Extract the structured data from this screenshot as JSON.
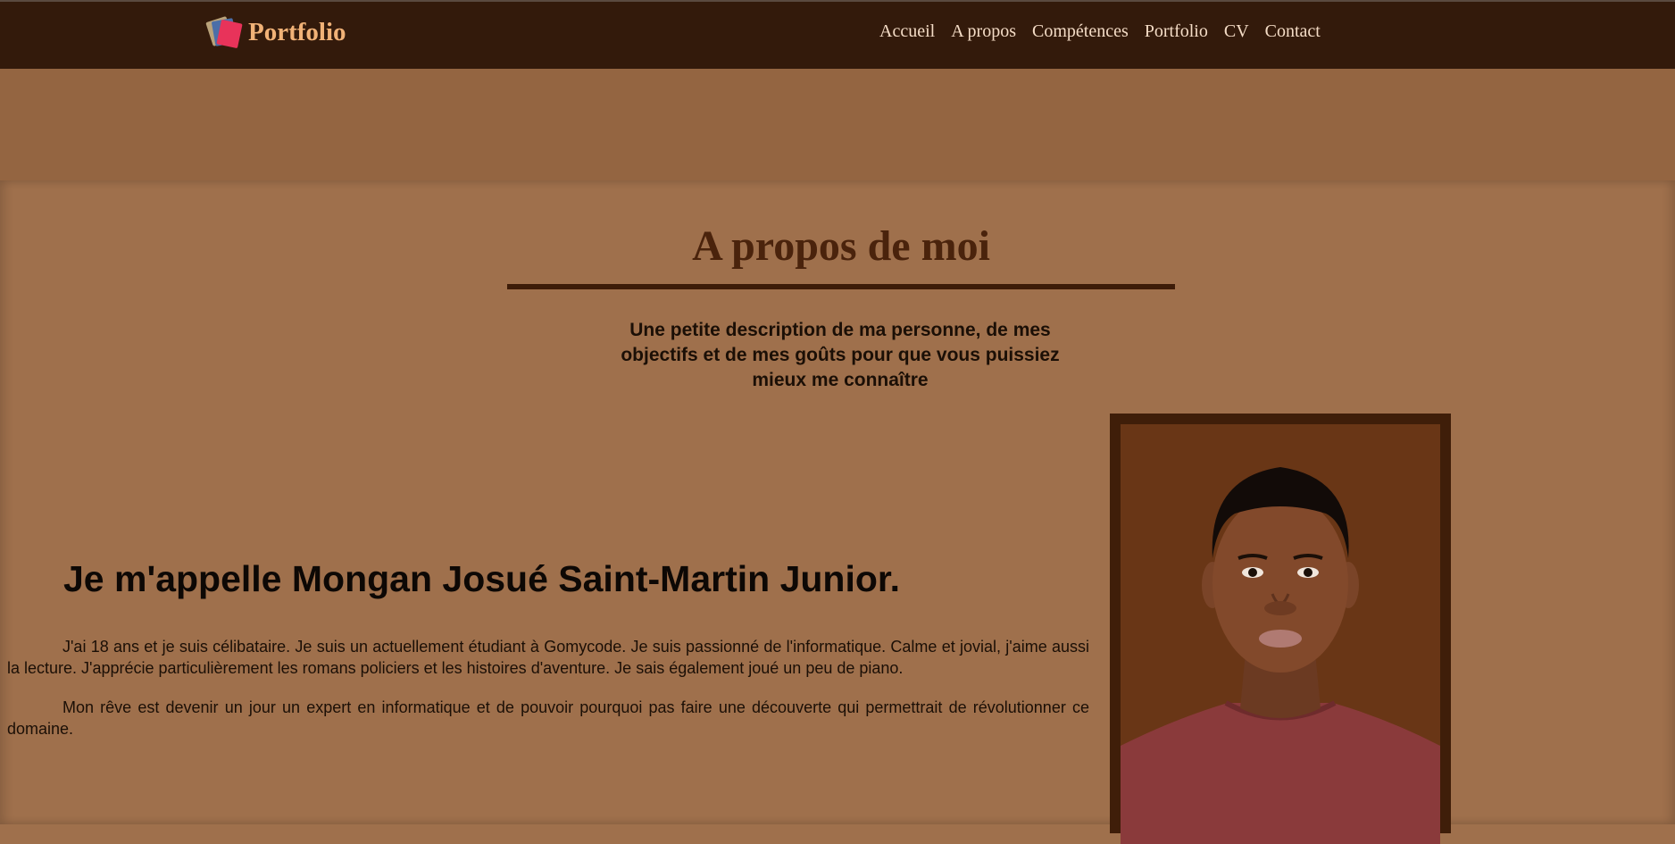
{
  "nav": {
    "brand": "Portfolio",
    "brand_icon": "books-icon",
    "links": [
      "Accueil",
      "A propos",
      "Compétences",
      "Portfolio",
      "CV",
      "Contact"
    ]
  },
  "about": {
    "title": "A propos de moi",
    "subtitle": "Une petite description de ma personne, de mes objectifs et de mes goûts pour que vous puissiez mieux me connaître",
    "name_heading": "Je m'appelle Mongan Josué Saint-Martin Junior.",
    "paragraph_1": "J'ai 18 ans et je suis célibataire. Je suis un actuellement étudiant à Gomycode. Je suis passionné de l'informatique. Calme et jovial, j'aime aussi la lecture. J'apprécie particulièrement les romans policiers et les histoires d'aventure. Je sais également joué un peu de piano.",
    "paragraph_2": "Mon rêve est devenir un jour un expert en informatique et de pouvoir pourquoi pas faire une découverte qui permettrait de révolutionner ce domaine."
  },
  "colors": {
    "navbar_bg": "#331a0b",
    "brand_color": "#f1b277",
    "banner_bg": "#946541",
    "section_bg": "#9f704c",
    "title_color": "#4a230c",
    "frame_color": "#3f1e09",
    "photo_bg": "#693616"
  }
}
